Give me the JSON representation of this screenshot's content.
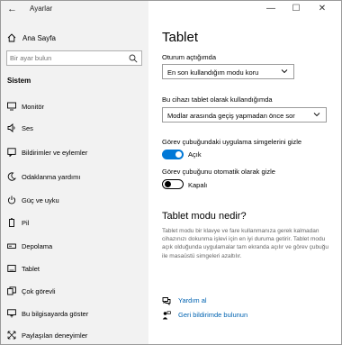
{
  "window": {
    "app_title": "Ayarlar",
    "back_symbol": "←",
    "minimize_symbol": "—",
    "maximize_symbol": "☐",
    "close_symbol": "✕"
  },
  "sidebar": {
    "home_label": "Ana Sayfa",
    "search_placeholder": "Bir ayar bulun",
    "section_label": "Sistem",
    "items": [
      {
        "label": "Monitör",
        "icon": "monitor-icon"
      },
      {
        "label": "Ses",
        "icon": "speaker-icon"
      },
      {
        "label": "Bildirimler ve eylemler",
        "icon": "notifications-icon"
      },
      {
        "label": "Odaklanma yardımı",
        "icon": "moon-icon"
      },
      {
        "label": "Güç ve uyku",
        "icon": "power-icon"
      },
      {
        "label": "Pil",
        "icon": "battery-icon"
      },
      {
        "label": "Depolama",
        "icon": "storage-icon"
      },
      {
        "label": "Tablet",
        "icon": "tablet-icon"
      },
      {
        "label": "Çok görevli",
        "icon": "multitasking-icon"
      },
      {
        "label": "Bu bilgisayarda göster",
        "icon": "project-icon"
      },
      {
        "label": "Paylaşılan deneyimler",
        "icon": "shared-experiences-icon"
      }
    ]
  },
  "main": {
    "title": "Tablet",
    "signin_label": "Oturum açtığımda",
    "signin_value": "En son kullandığım modu koru",
    "tablet_use_label": "Bu cihazı tablet olarak kullandığımda",
    "tablet_use_value": "Modlar arasında geçiş yapmadan önce sor",
    "hide_icons_label": "Görev çubuğundaki uygulama simgelerini gizle",
    "hide_icons_state": "Açık",
    "auto_hide_label": "Görev çubuğunu otomatik olarak gizle",
    "auto_hide_state": "Kapalı",
    "section_title": "Tablet modu nedir?",
    "description": "Tablet modu bir klavye ve fare kullanmanıza gerek kalmadan cihazınızı dokunma işlevi için en iyi duruma getirir. Tablet modu açık olduğunda uygulamalar tam ekranda açılır ve görev çubuğu ile masaüstü simgeleri azaltılır.",
    "help_link": "Yardım al",
    "feedback_link": "Geri bildirimde bulunun"
  },
  "colors": {
    "accent": "#0078d7",
    "link": "#0063b1",
    "sidebar_bg": "#f2f2f2"
  }
}
